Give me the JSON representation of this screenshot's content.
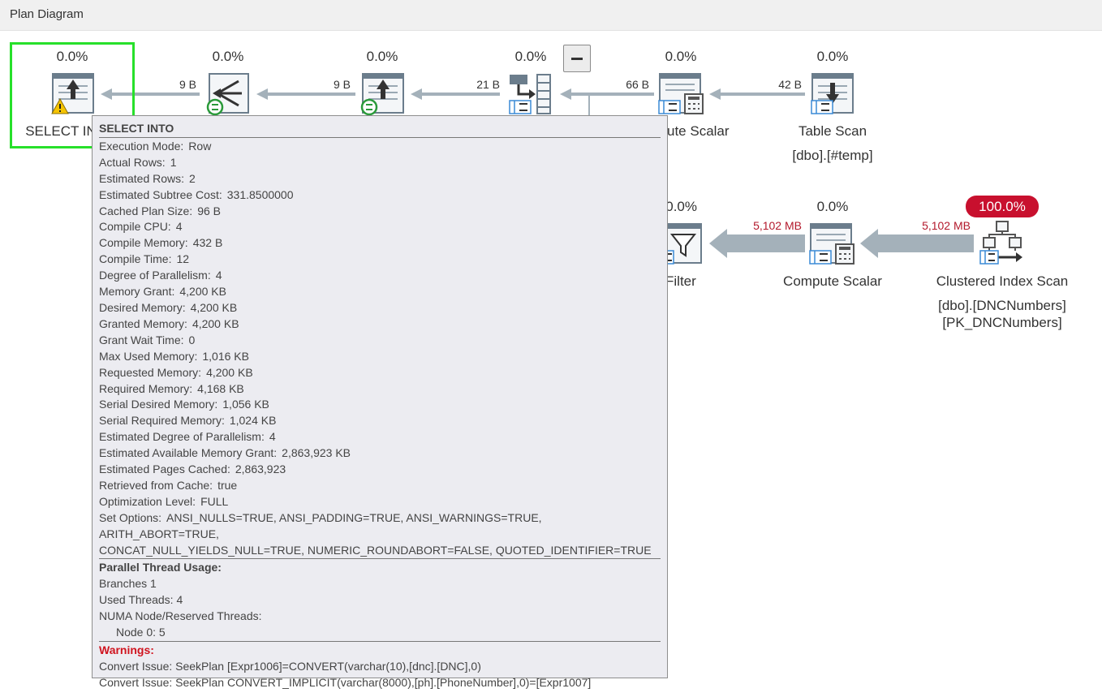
{
  "window": {
    "title": "Plan Diagram"
  },
  "operators": [
    {
      "id": "select-into",
      "pct": "0.0%",
      "label": "SELECT INTO",
      "object": ""
    },
    {
      "id": "gather-streams",
      "pct": "0.0%",
      "label": "",
      "object": ""
    },
    {
      "id": "distribute-streams",
      "pct": "0.0%",
      "label": "",
      "object": ""
    },
    {
      "id": "hash-match",
      "pct": "0.0%",
      "label": "",
      "object": ""
    },
    {
      "id": "compute-scalar-top",
      "pct": "0.0%",
      "label": "Compute Scalar",
      "object": ""
    },
    {
      "id": "table-scan",
      "pct": "0.0%",
      "label": "Table Scan",
      "object": "[dbo].[#temp]"
    },
    {
      "id": "filter",
      "pct": "0.0%",
      "label": "Filter",
      "object": ""
    },
    {
      "id": "compute-scalar-bottom",
      "pct": "0.0%",
      "label": "Compute Scalar",
      "object": ""
    },
    {
      "id": "clustered-index-scan",
      "pct": "100.0%",
      "label": "Clustered Index Scan",
      "object_lines": [
        "[dbo].[DNCNumbers]",
        "[PK_DNCNumbers]"
      ]
    }
  ],
  "edges": [
    {
      "label": "9 B"
    },
    {
      "label": "9 B"
    },
    {
      "label": "21 B"
    },
    {
      "label": "66 B"
    },
    {
      "label": "42 B"
    },
    {
      "label": "5,102 MB"
    },
    {
      "label": "5,102 MB"
    }
  ],
  "visible_labels": {
    "select_into_partial": "SELECT IN",
    "compute_scalar_partial": "ute Scalar",
    "filter_pct_partial": "0.0%",
    "filter_label_partial": "Filter"
  },
  "tooltip": {
    "title": "SELECT INTO",
    "properties": [
      {
        "k": "Execution Mode:",
        "v": "Row"
      },
      {
        "k": "Actual Rows:",
        "v": "1"
      },
      {
        "k": "Estimated Rows:",
        "v": "2"
      },
      {
        "k": "Estimated Subtree Cost:",
        "v": "331.8500000"
      },
      {
        "k": "Cached Plan Size:",
        "v": "96 B"
      },
      {
        "k": "Compile CPU:",
        "v": "4"
      },
      {
        "k": "Compile Memory:",
        "v": "432 B"
      },
      {
        "k": "Compile Time:",
        "v": "12"
      },
      {
        "k": "Degree of Parallelism:",
        "v": "4"
      },
      {
        "k": "Memory Grant:",
        "v": "4,200 KB"
      },
      {
        "k": "Desired Memory:",
        "v": "4,200 KB"
      },
      {
        "k": "Granted Memory:",
        "v": "4,200 KB"
      },
      {
        "k": "Grant Wait Time:",
        "v": "0"
      },
      {
        "k": "Max Used Memory:",
        "v": "1,016 KB"
      },
      {
        "k": "Requested Memory:",
        "v": "4,200 KB"
      },
      {
        "k": "Required Memory:",
        "v": "4,168 KB"
      },
      {
        "k": "Serial Desired Memory:",
        "v": "1,056 KB"
      },
      {
        "k": "Serial Required Memory:",
        "v": "1,024 KB"
      },
      {
        "k": "Estimated Degree of Parallelism:",
        "v": "4"
      },
      {
        "k": "Estimated Available Memory Grant:",
        "v": "2,863,923 KB"
      },
      {
        "k": "Estimated Pages Cached:",
        "v": "2,863,923"
      },
      {
        "k": "Retrieved from Cache:",
        "v": "true"
      },
      {
        "k": "Optimization Level:",
        "v": "FULL"
      },
      {
        "k": "Set Options:",
        "v": "ANSI_NULLS=TRUE, ANSI_PADDING=TRUE, ANSI_WARNINGS=TRUE, ARITH_ABORT=TRUE,"
      }
    ],
    "set_options_cont": "CONCAT_NULL_YIELDS_NULL=TRUE, NUMERIC_ROUNDABORT=FALSE, QUOTED_IDENTIFIER=TRUE",
    "parallel_title": "Parallel Thread Usage:",
    "branches": "Branches 1",
    "used_threads": "Used Threads: 4",
    "numa": "NUMA Node/Reserved Threads:",
    "node": "Node 0: 5",
    "warnings_title": "Warnings:",
    "warnings": [
      "Convert Issue: SeekPlan [Expr1006]=CONVERT(varchar(10),[dnc].[DNC],0)",
      "Convert Issue: SeekPlan CONVERT_IMPLICIT(varchar(8000),[ph].[PhoneNumber],0)=[Expr1007]"
    ]
  },
  "colors": {
    "selection": "#27e02a",
    "badge": "#c8102e",
    "warning_text": "#d0141f",
    "big_edge_text": "#b3192c",
    "edge": "#a4b1ba"
  }
}
